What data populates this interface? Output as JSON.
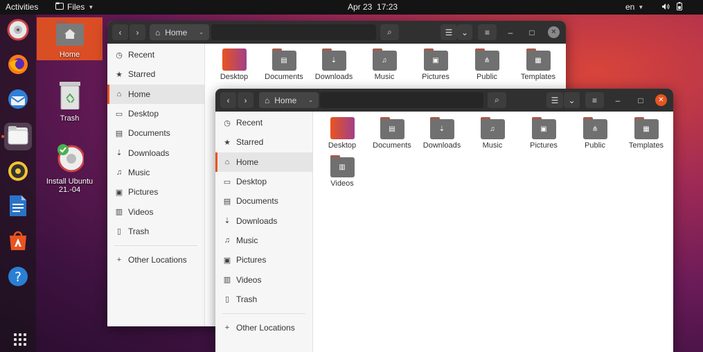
{
  "topbar": {
    "activities": "Activities",
    "app_menu": "Files",
    "clock": "Apr 23  17:23",
    "language": "en"
  },
  "dock": {
    "apps": [
      {
        "name": "rhythmbox",
        "label": ""
      },
      {
        "name": "firefox",
        "label": ""
      },
      {
        "name": "thunderbird",
        "label": ""
      },
      {
        "name": "files",
        "label": ""
      },
      {
        "name": "rhythmbox-music",
        "label": ""
      },
      {
        "name": "writer",
        "label": ""
      },
      {
        "name": "software",
        "label": ""
      },
      {
        "name": "help",
        "label": ""
      }
    ]
  },
  "desktop": {
    "icons": [
      {
        "label": "Home"
      },
      {
        "label": "Trash"
      },
      {
        "label": "Install Ubuntu 21.-04"
      }
    ]
  },
  "windows": {
    "path_label": "Home",
    "sidebar": [
      "Recent",
      "Starred",
      "Home",
      "Desktop",
      "Documents",
      "Downloads",
      "Music",
      "Pictures",
      "Videos",
      "Trash"
    ],
    "other_locations": "Other Locations",
    "folders_back": [
      "Desktop",
      "Documents",
      "Downloads",
      "Music",
      "Pictures",
      "Public",
      "Templates"
    ],
    "folders_front": [
      "Desktop",
      "Documents",
      "Downloads",
      "Music",
      "Pictures",
      "Public",
      "Templates",
      "Videos"
    ]
  },
  "colors": {
    "accent": "#e95420",
    "folder_grey": "#707070",
    "folder_tab": "#a85a4a"
  }
}
